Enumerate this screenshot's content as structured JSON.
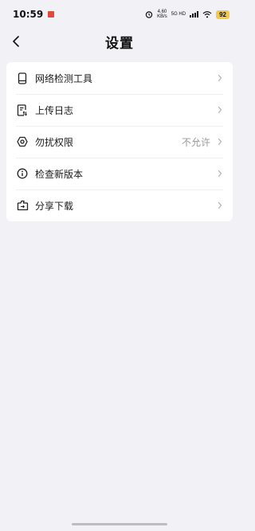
{
  "status_bar": {
    "time": "10:59",
    "net_speed_value": "4.60",
    "net_speed_unit": "KB/s",
    "net_type_top": "5G HD",
    "battery": "92"
  },
  "header": {
    "title": "设置"
  },
  "settings": {
    "items": [
      {
        "label": "网络检测工具",
        "value": "",
        "icon": "phone-icon"
      },
      {
        "label": "上传日志",
        "value": "",
        "icon": "upload-log-icon"
      },
      {
        "label": "勿扰权限",
        "value": "不允许",
        "icon": "hexagon-nut-icon"
      },
      {
        "label": "检查新版本",
        "value": "",
        "icon": "info-icon"
      },
      {
        "label": "分享下载",
        "value": "",
        "icon": "share-icon"
      }
    ]
  },
  "colors": {
    "background": "#f2f1f6",
    "card": "#ffffff",
    "value_text": "#9a9a9a",
    "battery": "#f2c94c"
  }
}
